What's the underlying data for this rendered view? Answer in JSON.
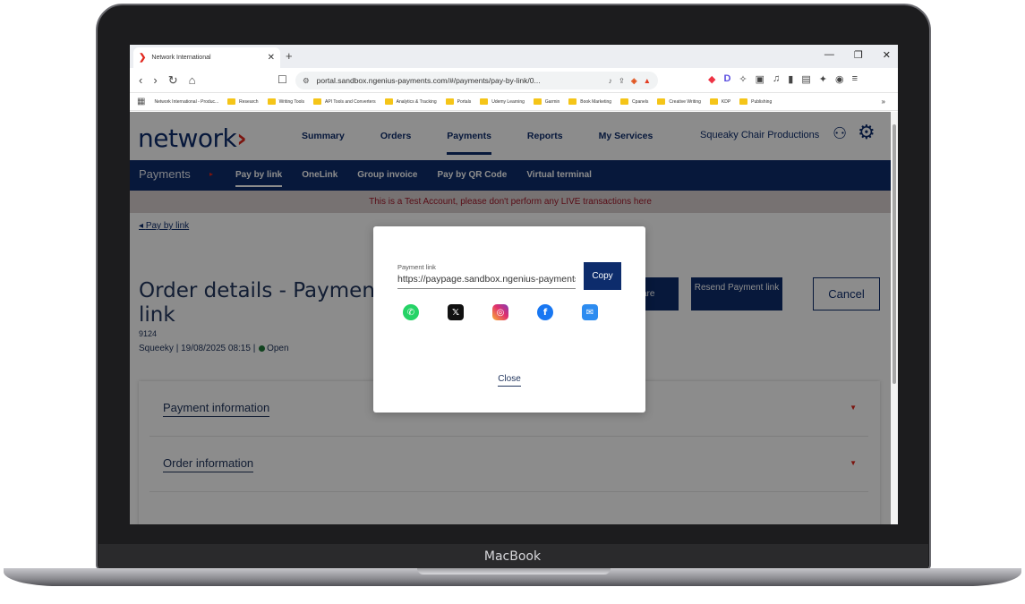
{
  "device": {
    "label": "MacBook"
  },
  "browser": {
    "tab_title": "Network International",
    "url": "portal.sandbox.ngenius-payments.com/#/payments/pay-by-link/0...",
    "bookmarks": [
      "Network International - Produc...",
      "Research",
      "Writing Tools",
      "API Tools and Converters",
      "Analytics & Tracking",
      "Portals",
      "Udemy Learning",
      "Garmin",
      "Book Marketing",
      "Cpanels",
      "Creative Writing",
      "KDP",
      "Publishing"
    ]
  },
  "header": {
    "logo": "network",
    "logo_chevron": "›",
    "menu": [
      "Summary",
      "Orders",
      "Payments",
      "Reports",
      "My Services"
    ],
    "company": "Squeaky Chair Productions"
  },
  "subnav": {
    "section": "Payments",
    "items": [
      "Pay by link",
      "OneLink",
      "Group invoice",
      "Pay by QR Code",
      "Virtual terminal"
    ]
  },
  "banner": {
    "text": "This is a Test Account, please don't perform any LIVE transactions here"
  },
  "order": {
    "back": "Pay by link",
    "title": "Order details - Payment link",
    "id": "9124",
    "meta_prefix": "Squeeky | 19/08/2025 08:15 |",
    "status": "Open",
    "share_label": "are",
    "resend_label": "Resend Payment link",
    "cancel_label": "Cancel",
    "sections": [
      "Payment information",
      "Order information"
    ]
  },
  "modal": {
    "label": "Payment link",
    "value": "https://paypage.sandbox.ngenius-payments.com",
    "copy": "Copy",
    "close": "Close",
    "share_icons": [
      "whatsapp-icon",
      "x-icon",
      "instagram-icon",
      "facebook-icon",
      "email-icon"
    ]
  },
  "colors": {
    "navy": "#0d2c6c",
    "red": "#e1251b",
    "banner_bg": "#d9cfcf",
    "banner_text": "#a0192a"
  }
}
